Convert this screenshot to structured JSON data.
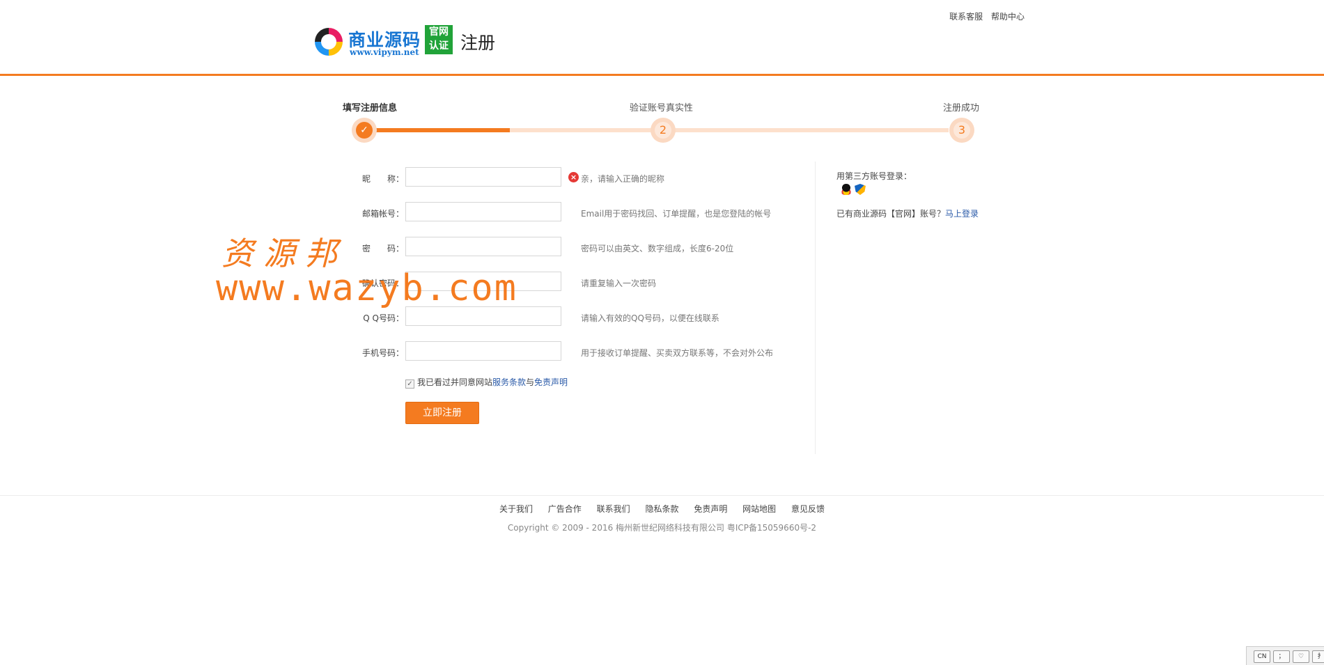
{
  "header": {
    "logo_name": "商业源码",
    "logo_url": "www.vipym.net",
    "logo_badge_top": "官网",
    "logo_badge_bottom": "认证",
    "page_title": "注册",
    "top_links": [
      "联系客服",
      "帮助中心"
    ]
  },
  "steps": {
    "items": [
      {
        "label": "填写注册信息",
        "marker": "✓",
        "status": "done"
      },
      {
        "label": "验证账号真实性",
        "marker": "2",
        "status": "pending"
      },
      {
        "label": "注册成功",
        "marker": "3",
        "status": "pending"
      }
    ],
    "progress_fraction": 0.25
  },
  "form": {
    "fields": [
      {
        "label": "昵　　称：",
        "value": "",
        "hint": "亲，请输入正确的昵称",
        "error": true
      },
      {
        "label": "邮箱帐号：",
        "value": "",
        "hint": "Email用于密码找回、订单提醒，也是您登陆的帐号",
        "error": false
      },
      {
        "label": "密　　码：",
        "value": "",
        "hint": "密码可以由英文、数字组成，长度6-20位",
        "error": false
      },
      {
        "label": "确认密码：",
        "value": "",
        "hint": "请重复输入一次密码",
        "error": false
      },
      {
        "label": "Q Q号码：",
        "value": "",
        "hint": "请输入有效的QQ号码，以便在线联系",
        "error": false
      },
      {
        "label": "手机号码：",
        "value": "",
        "hint": "用于接收订单提醒、买卖双方联系等，不会对外公布",
        "error": false
      }
    ],
    "error_icon": "×",
    "agree": {
      "checked": true,
      "checkmark": "✓",
      "text": "我已看过并同意网站",
      "terms_link": "服务条款",
      "and": "与",
      "disclaimer_link": "免责声明"
    },
    "submit_label": "立即注册"
  },
  "sidebar": {
    "third_party_label": "用第三方账号登录：",
    "social_icons": [
      "qq-icon",
      "shield-icon"
    ],
    "have_account_text": "已有商业源码【官网】账号？",
    "login_link": "马上登录"
  },
  "watermark": {
    "line1": "资源邦",
    "line2": "www.wazyb.com"
  },
  "footer": {
    "links": [
      "关于我们",
      "广告合作",
      "联系我们",
      "隐私条款",
      "免责声明",
      "网站地图",
      "意见反馈"
    ],
    "copyright": "Copyright © 2009 - 2016 梅州新世纪网络科技有限公司 粤ICP备15059660号-2"
  },
  "tray": {
    "items": [
      "CN",
      "；",
      "♡",
      "扌"
    ]
  },
  "colors": {
    "accent": "#f47b20",
    "link": "#2a5aa8",
    "badge": "#21a339",
    "error": "#e53935"
  }
}
